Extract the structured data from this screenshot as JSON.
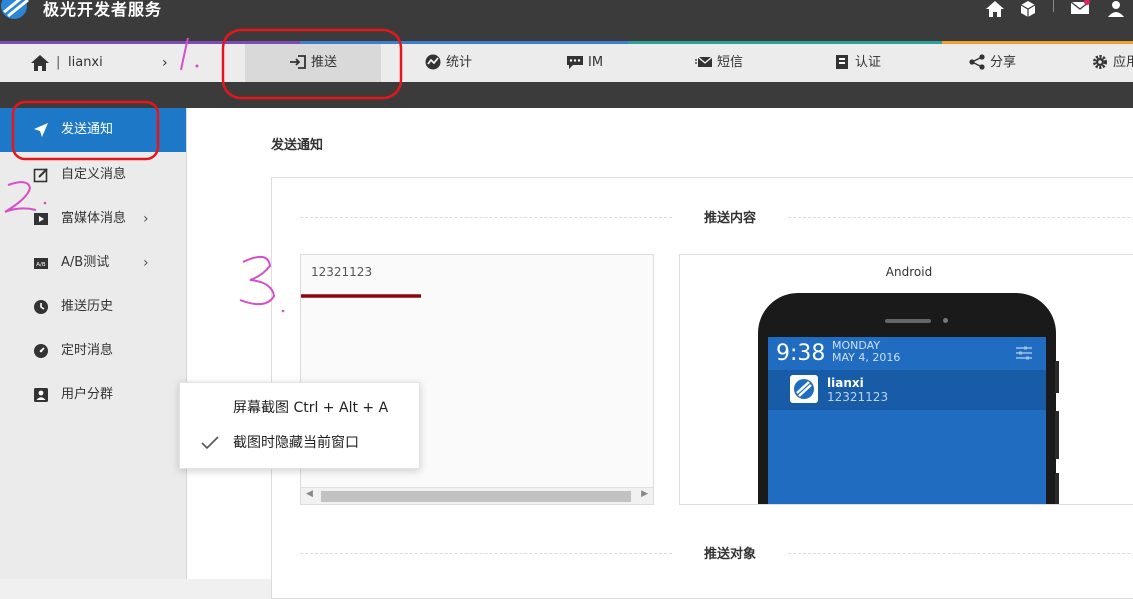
{
  "header": {
    "brand": "极光开发者服务",
    "icons": [
      "logo-icon",
      "home-icon",
      "cube-icon",
      "mail-icon",
      "user-icon"
    ]
  },
  "navbar": {
    "project_name": "lianxi",
    "separator": "|",
    "chevron": "›",
    "items": [
      {
        "label": "推送",
        "icon": "push-icon",
        "active": true
      },
      {
        "label": "统计",
        "icon": "stats-icon"
      },
      {
        "label": "IM",
        "icon": "im-icon"
      },
      {
        "label": "短信",
        "icon": "sms-icon"
      },
      {
        "label": "认证",
        "icon": "auth-icon"
      },
      {
        "label": "分享",
        "icon": "share-icon"
      },
      {
        "label": "应用",
        "icon": "gear-icon"
      }
    ]
  },
  "sidebar": {
    "items": [
      {
        "label": "发送通知",
        "icon": "send-icon",
        "active": true
      },
      {
        "label": "自定义消息",
        "icon": "edit-icon"
      },
      {
        "label": "富媒体消息",
        "icon": "media-icon",
        "arrow": "›"
      },
      {
        "label": "A/B测试",
        "icon": "ab-test-icon",
        "arrow": "›"
      },
      {
        "label": "推送历史",
        "icon": "history-icon"
      },
      {
        "label": "定时消息",
        "icon": "timer-icon"
      },
      {
        "label": "用户分群",
        "icon": "user-group-icon"
      }
    ]
  },
  "main": {
    "title": "发送通知",
    "section_content": "推送内容",
    "section_target": "推送对象",
    "content_text": "12321123",
    "preview": {
      "platform": "Android",
      "time": "9:38",
      "day": "MONDAY",
      "date": "MAY 4, 2016",
      "app_name": "lianxi",
      "message": "12321123"
    }
  },
  "context_menu": {
    "items": [
      {
        "label": "屏幕截图 Ctrl + Alt + A",
        "checked": false
      },
      {
        "label": "截图时隐藏当前窗口",
        "checked": true
      }
    ]
  },
  "annotations": {
    "colors": {
      "highlight": "#e8141c",
      "handwriting": "#d44fc8",
      "underline": "#8b0a12"
    },
    "marks": [
      "1.",
      "2.",
      "3."
    ]
  },
  "colors": {
    "topbar": "#3b3b3b",
    "accent_blue": "#1e78c8",
    "phone_screen": "#1f6cc0"
  }
}
